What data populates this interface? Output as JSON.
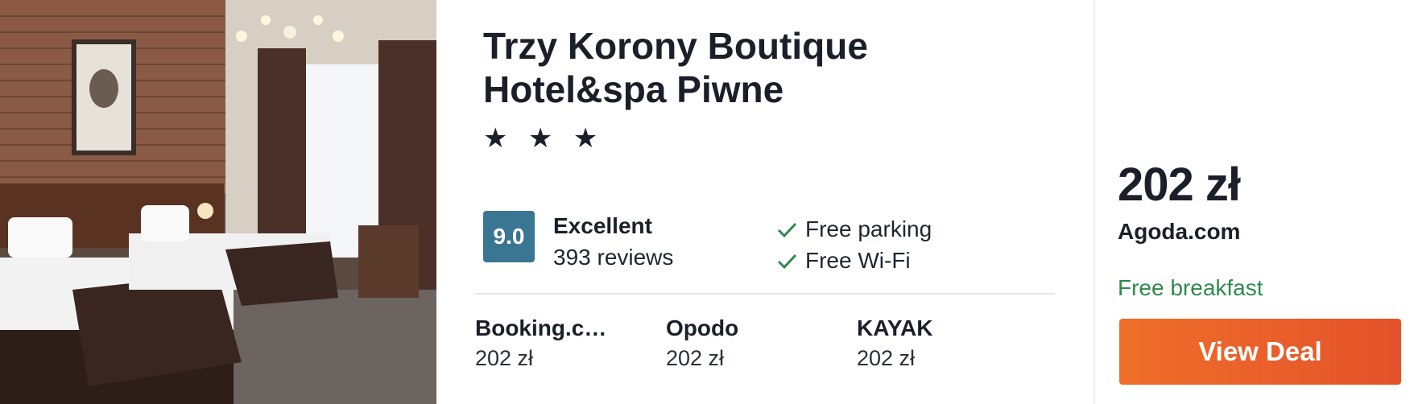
{
  "hotel": {
    "name": "Trzy Korony Boutique Hotel&spa Piwne",
    "stars": "★ ★ ★",
    "rating": {
      "score": "9.0",
      "label": "Excellent",
      "reviews": "393 reviews"
    },
    "amenities": [
      "Free parking",
      "Free Wi-Fi"
    ]
  },
  "providers": [
    {
      "name": "Booking.c…",
      "price": "202 zł"
    },
    {
      "name": "Opodo",
      "price": "202 zł"
    },
    {
      "name": "KAYAK",
      "price": "202 zł"
    }
  ],
  "deal": {
    "price": "202 zł",
    "site": "Agoda.com",
    "perk": "Free breakfast",
    "button_label": "View Deal"
  },
  "colors": {
    "score_badge": "#3a7591",
    "perk": "#2e8a4a",
    "button": "#e4522a",
    "check": "#2e8a4a"
  },
  "icons": {
    "amenity_check": "check-icon",
    "star": "star-icon"
  }
}
